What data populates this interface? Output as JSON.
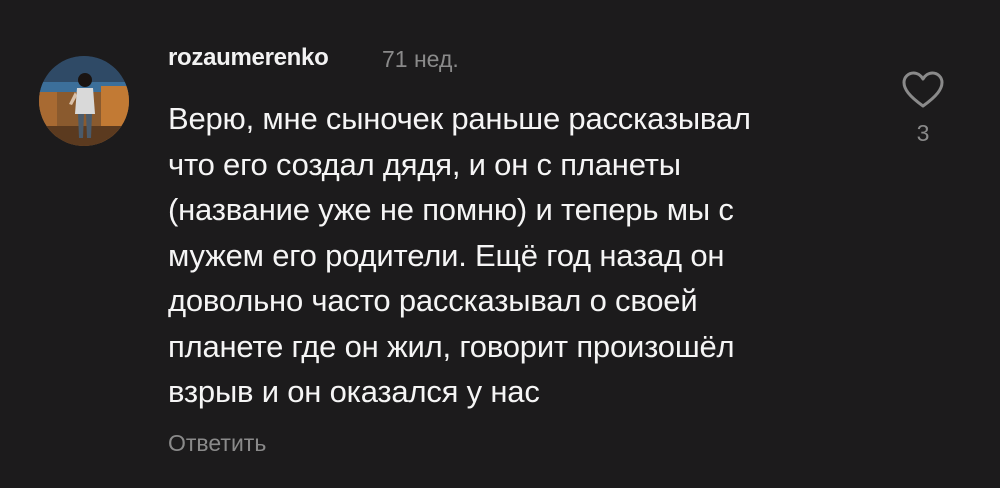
{
  "comment": {
    "username": "rozaumerenko",
    "timestamp": "71 нед.",
    "text": "Верю, мне сыночек раньше рассказывал\nчто его создал дядя, и он с планеты\n(название уже не помню) и теперь мы с\nмужем его родители. Ещё год назад он\nдовольно часто рассказывал о своей\nпланете где он жил, говорит произошёл\nвзрыв и он оказался у нас",
    "like_count": "3",
    "reply_label": "Ответить",
    "avatar_icon": "user-avatar-photo",
    "like_icon": "heart-outline-icon"
  },
  "colors": {
    "background": "#1c1b1c",
    "text": "#f5f5f5",
    "muted": "#8a8a8a"
  }
}
